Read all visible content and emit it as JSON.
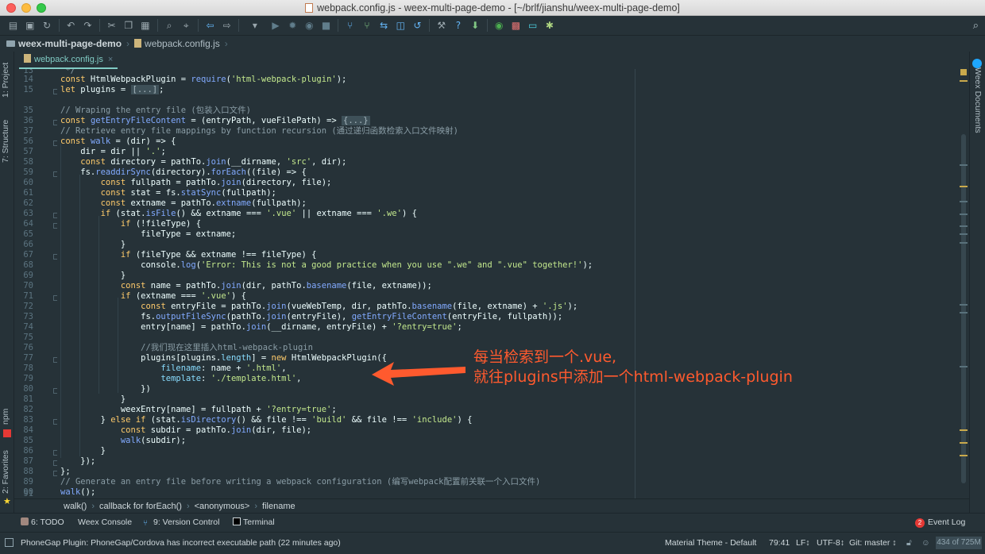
{
  "window": {
    "title": "webpack.config.js - weex-multi-page-demo - [~/brlf/jianshu/weex-multi-page-demo]"
  },
  "toolbar": {
    "icons": [
      "open-folder-icon",
      "save-icon",
      "sync-icon",
      "undo-icon",
      "redo-icon",
      "cut-icon",
      "copy-icon",
      "paste-icon",
      "find-icon",
      "replace-icon",
      "back-icon",
      "forward-icon",
      "run-config-dropdown-icon",
      "run-icon",
      "debug-icon",
      "coverage-icon",
      "stop-icon",
      "vcs-update-icon",
      "vcs-commit-icon",
      "vcs-compare-icon",
      "vcs-history-icon",
      "vcs-revert-icon",
      "vcs-branch-icon",
      "help-icon",
      "sdk-manager-icon",
      "weex-run-icon",
      "plugin-icon",
      "device-icon",
      "puzzle-icon"
    ]
  },
  "navbar": {
    "project": "weex-multi-page-demo",
    "file": "webpack.config.js"
  },
  "left_tabs": {
    "project": "1: Project",
    "structure": "7: Structure",
    "npm": "npm",
    "favorites": "2: Favorites"
  },
  "right_tabs": {
    "weex_docs": "Weex Documents"
  },
  "editor": {
    "tab_label": "webpack.config.js",
    "line_numbers": [
      "13",
      "14",
      "15",
      "35",
      "36",
      "37",
      "56",
      "57",
      "58",
      "59",
      "60",
      "61",
      "62",
      "63",
      "64",
      "65",
      "66",
      "67",
      "68",
      "69",
      "70",
      "71",
      "72",
      "73",
      "74",
      "75",
      "76",
      "77",
      "78",
      "79",
      "80",
      "81",
      "82",
      "83",
      "84",
      "85",
      "86",
      "87",
      "88",
      "89",
      "90",
      "91"
    ]
  },
  "breadcrumb": {
    "items": [
      "walk()",
      "callback for forEach()",
      "<anonymous>",
      "filename"
    ]
  },
  "bottom_tools": {
    "todo": "6: TODO",
    "weex_console": "Weex Console",
    "version_control": "9: Version Control",
    "terminal": "Terminal",
    "event_log": "Event Log",
    "event_count": "2"
  },
  "status": {
    "message": "PhoneGap Plugin: PhoneGap/Cordova has incorrect executable path (22 minutes ago)",
    "theme": "Material Theme - Default",
    "position": "79:41",
    "line_sep": "LF↕",
    "encoding": "UTF-8↕",
    "git": "Git: master ↕",
    "memory": "434 of 725M"
  },
  "annotation": {
    "line1": "每当检索到一个.vue,",
    "line2": "就往plugins中添加一个html-webpack-plugin"
  },
  "colors": {
    "background": "#263238",
    "keyword": "#ffcb6b",
    "string": "#c3e88d",
    "annotation": "#ff5a2e"
  }
}
